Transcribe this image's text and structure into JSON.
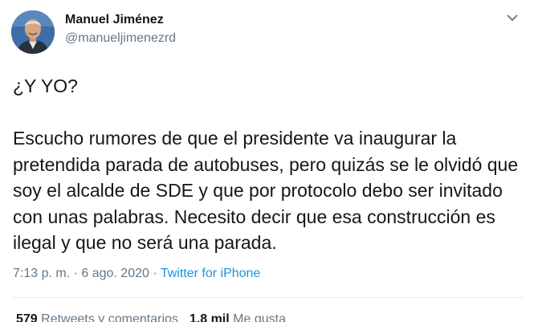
{
  "author": {
    "name": "Manuel Jiménez",
    "handle": "@manueljimenezrd"
  },
  "tweet": {
    "text": "¿Y YO?\n\nEscucho rumores de que el presidente va inaugurar la pretendida parada de autobuses, pero quizás se le olvidó que soy el alcalde de SDE y que por protocolo debo ser invitado con unas palabras. Necesito decir que esa construcción es ilegal y que no será una parada."
  },
  "meta": {
    "timestamp": "7:13 p. m. · 6 ago. 2020",
    "separator": " · ",
    "source": "Twitter for iPhone"
  },
  "stats": {
    "retweets_count": "579",
    "retweets_label": "Retweets y comentarios",
    "likes_count": "1,8 mil",
    "likes_label": "Me gusta"
  },
  "icons": {
    "menu": "chevron-down-icon"
  },
  "colors": {
    "link": "#1b95e0",
    "secondary_text": "#657786",
    "primary_text": "#14171a"
  }
}
